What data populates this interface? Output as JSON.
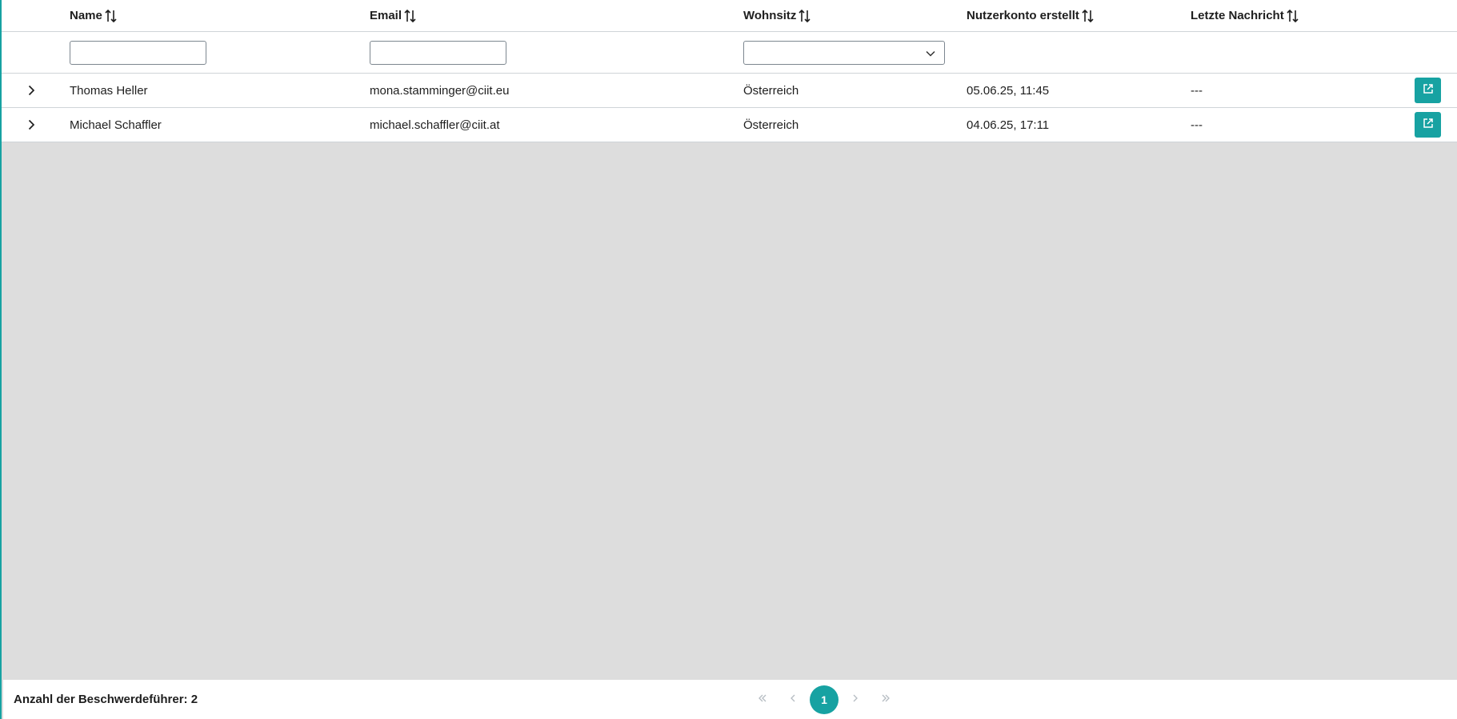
{
  "table": {
    "columns": {
      "name": "Name",
      "email": "Email",
      "wohnsitz": "Wohnsitz",
      "created": "Nutzerkonto erstellt",
      "last_message": "Letzte Nachricht"
    },
    "filters": {
      "name_value": "",
      "email_value": "",
      "wohnsitz_selected": ""
    },
    "rows": [
      {
        "name": "Thomas Heller",
        "email": "mona.stamminger@ciit.eu",
        "wohnsitz": "Österreich",
        "created": "05.06.25, 11:45",
        "last_message": "---"
      },
      {
        "name": "Michael Schaffler",
        "email": "michael.schaffler@ciit.at",
        "wohnsitz": "Österreich",
        "created": "04.06.25, 17:11",
        "last_message": "---"
      }
    ]
  },
  "footer": {
    "count_label": "Anzahl der Beschwerdeführer: 2",
    "current_page": "1"
  },
  "icons": {
    "sort": "sort-icon",
    "expand": "chevron-right-icon",
    "external": "external-link-icon",
    "dropdown": "chevron-down-icon",
    "first": "double-chevron-left-icon",
    "prev": "chevron-left-icon",
    "next": "chevron-right-icon",
    "last": "double-chevron-right-icon"
  },
  "colors": {
    "accent": "#17a2a2",
    "empty_area": "#dddddd",
    "pager_disabled": "#b5bcc2"
  }
}
